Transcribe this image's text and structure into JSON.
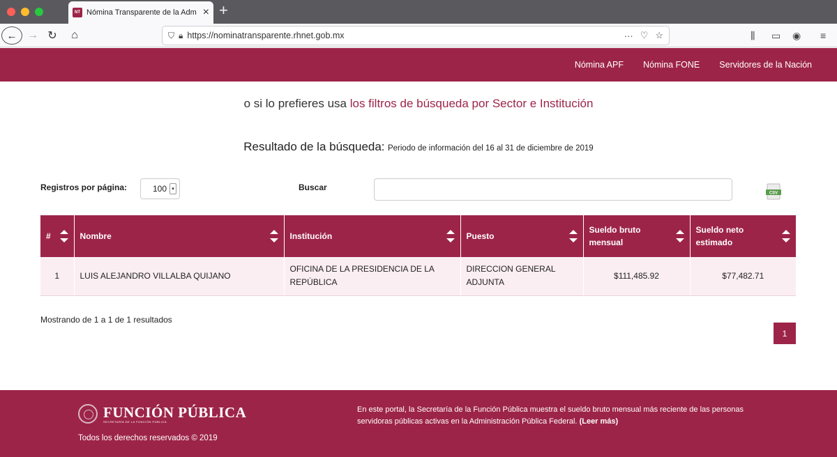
{
  "browser": {
    "tab_title": "Nómina Transparente de la Adm",
    "favicon_text": "NT",
    "url": "https://nominatransparente.rhnet.gob.mx",
    "icons": [
      "back-icon",
      "forward-icon",
      "reload-icon",
      "home-icon",
      "shield-icon",
      "lock-icon",
      "more-icon",
      "pocket-icon",
      "star-icon",
      "library-icon",
      "sidebar-icon",
      "account-icon",
      "menu-icon"
    ]
  },
  "header": {
    "nav": [
      "Nómina APF",
      "Nómina FONE",
      "Servidores de la Nación"
    ]
  },
  "content": {
    "filter_prefix": "o si lo prefieres usa",
    "filter_link": "los filtros de búsqueda por Sector e Institución",
    "result_title": "Resultado de la búsqueda:",
    "result_period": "Periodo de información del 16 al 31 de diciembre de 2019",
    "records_label": "Registros por página:",
    "records_value": "100",
    "search_label": "Buscar",
    "search_value": ""
  },
  "table": {
    "headers": [
      "#",
      "Nombre",
      "Institución",
      "Puesto",
      "Sueldo bruto mensual",
      "Sueldo neto estimado"
    ],
    "rows": [
      [
        "1",
        "LUIS ALEJANDRO VILLALBA QUIJANO",
        "OFICINA DE LA PRESIDENCIA DE LA REPÚBLICA",
        "DIRECCION GENERAL ADJUNTA",
        "$111,485.92",
        "$77,482.71"
      ]
    ]
  },
  "pagination": {
    "showing": "Mostrando de 1 a 1 de 1 resultados",
    "current_page": "1"
  },
  "footer": {
    "logo_main": "FUNCIÓN PÚBLICA",
    "logo_sub": "SECRETARÍA DE LA FUNCIÓN PÚBLICA",
    "rights": "Todos los derechos reservados © 2019",
    "description": "En este portal, la Secretaría de la Función Pública muestra el sueldo bruto mensual más reciente de las personas servidoras públicas activas en la Administración Pública Federal.",
    "read_more": "(Leer más)"
  },
  "colors": {
    "brand": "#9d2449",
    "row_bg": "#fbeef2"
  }
}
